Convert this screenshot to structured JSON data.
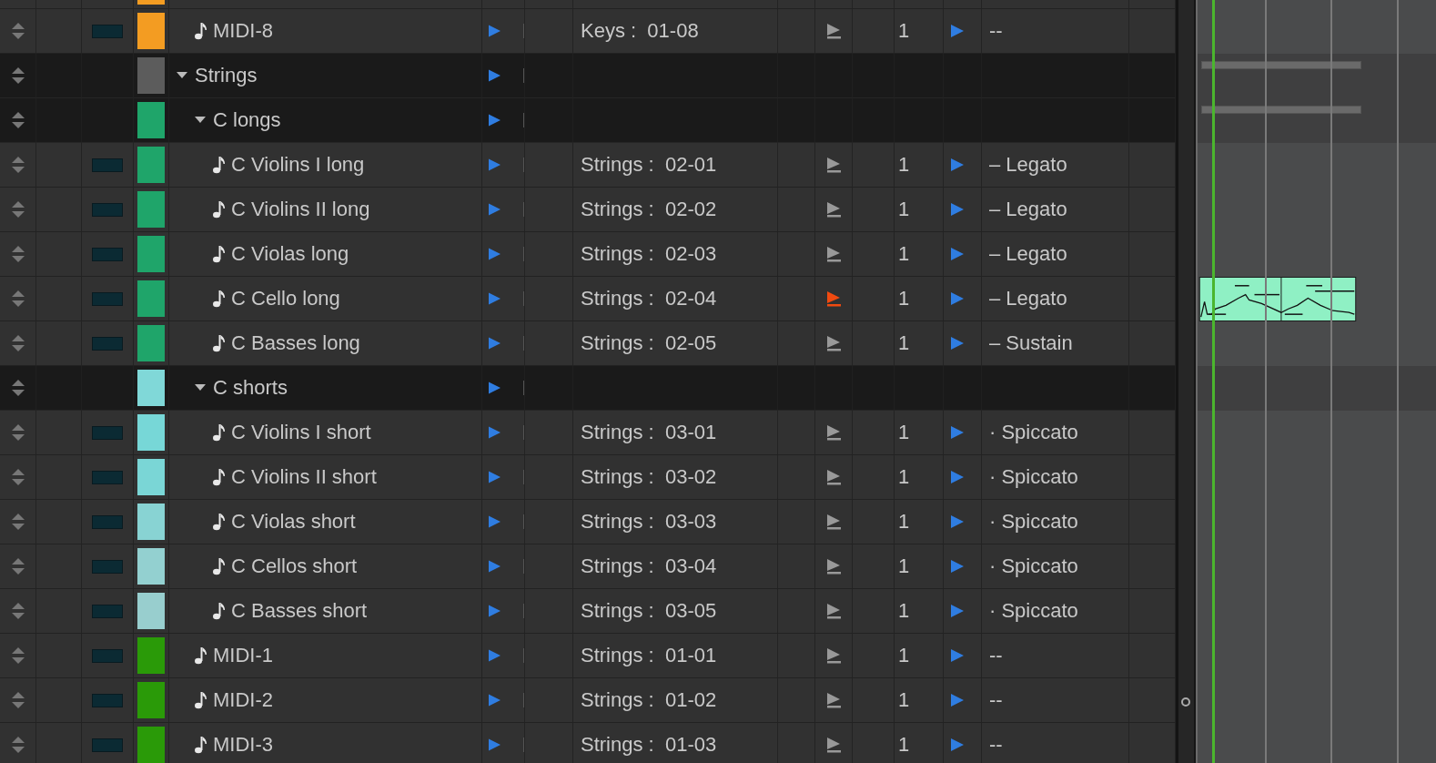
{
  "tracks": [
    {
      "kind": "offscreen-folder",
      "children": [
        {
          "kind": "stub",
          "color": "#f39c22"
        },
        {
          "kind": "track",
          "name": "MIDI-8",
          "color": "#f39c22",
          "port": "Keys :  01-08",
          "flag_on": false,
          "channel": "1",
          "articulation": "--"
        }
      ]
    },
    {
      "kind": "folder",
      "name": "Strings",
      "color": "#5c5c5c",
      "expanded": true,
      "summary": true,
      "children": [
        {
          "kind": "folder",
          "name": "C longs",
          "color": "#1fa56a",
          "expanded": true,
          "summary": true,
          "children": [
            {
              "kind": "track",
              "name": "C Violins I long",
              "color": "#1fa56a",
              "port": "Strings :  02-01",
              "flag_on": false,
              "channel": "1",
              "articulation": "– Legato"
            },
            {
              "kind": "track",
              "name": "C Violins II long",
              "color": "#1fa56a",
              "port": "Strings :  02-02",
              "flag_on": false,
              "channel": "1",
              "articulation": "– Legato"
            },
            {
              "kind": "track",
              "name": "C Violas long",
              "color": "#1fa56a",
              "port": "Strings :  02-03",
              "flag_on": false,
              "channel": "1",
              "articulation": "– Legato"
            },
            {
              "kind": "track",
              "name": "C Cello long",
              "color": "#1fa56a",
              "port": "Strings :  02-04",
              "flag_on": true,
              "channel": "1",
              "articulation": "– Legato",
              "clip": true
            },
            {
              "kind": "track",
              "name": "C Basses long",
              "color": "#1fa56a",
              "port": "Strings :  02-05",
              "flag_on": false,
              "channel": "1",
              "articulation": "– Sustain"
            }
          ]
        },
        {
          "kind": "folder",
          "name": "C shorts",
          "color": "#80d8d8",
          "expanded": true,
          "summary": false,
          "children": [
            {
              "kind": "track",
              "name": "C Violins I short",
              "color": "#77d7d7",
              "port": "Strings :  03-01",
              "flag_on": false,
              "channel": "1",
              "articulation": "· Spiccato"
            },
            {
              "kind": "track",
              "name": "C Violins II short",
              "color": "#7ad6d6",
              "port": "Strings :  03-02",
              "flag_on": false,
              "channel": "1",
              "articulation": "· Spiccato"
            },
            {
              "kind": "track",
              "name": "C Violas short",
              "color": "#88d3d3",
              "port": "Strings :  03-03",
              "flag_on": false,
              "channel": "1",
              "articulation": "· Spiccato"
            },
            {
              "kind": "track",
              "name": "C Cellos short",
              "color": "#93d0d0",
              "port": "Strings :  03-04",
              "flag_on": false,
              "channel": "1",
              "articulation": "· Spiccato"
            },
            {
              "kind": "track",
              "name": "C Basses short",
              "color": "#98cece",
              "port": "Strings :  03-05",
              "flag_on": false,
              "channel": "1",
              "articulation": "· Spiccato"
            }
          ]
        },
        {
          "kind": "track",
          "name": "MIDI-1",
          "color": "#2a9a08",
          "port": "Strings :  01-01",
          "flag_on": false,
          "channel": "1",
          "articulation": "--"
        },
        {
          "kind": "track",
          "name": "MIDI-2",
          "color": "#2a9a08",
          "port": "Strings :  01-02",
          "flag_on": false,
          "channel": "1",
          "articulation": "--"
        },
        {
          "kind": "track",
          "name": "MIDI-3",
          "color": "#2a9a08",
          "port": "Strings :  01-03",
          "flag_on": false,
          "channel": "1",
          "articulation": "--"
        }
      ]
    }
  ]
}
